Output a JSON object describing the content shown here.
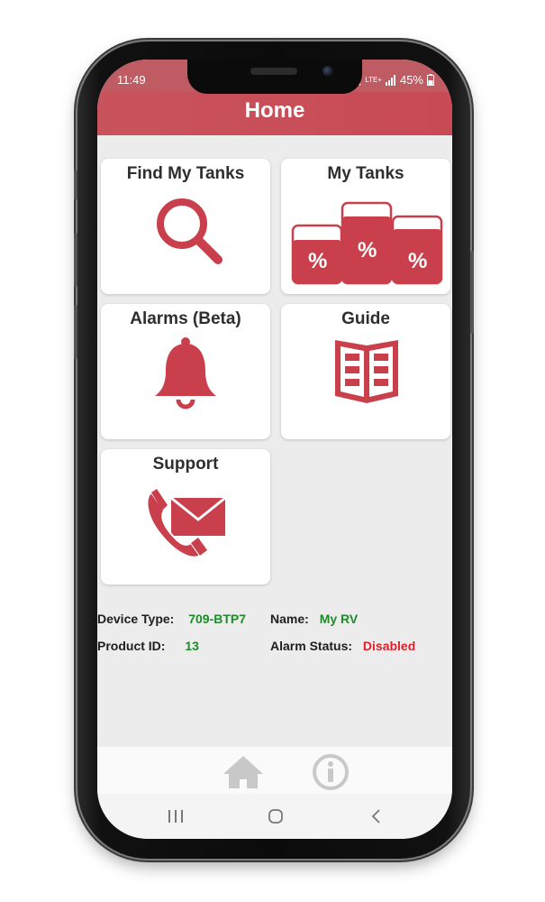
{
  "status_bar": {
    "time": "11:49",
    "network": "LTE+",
    "battery": "45%"
  },
  "app_bar": {
    "title": "Home"
  },
  "tiles": [
    {
      "label": "Find My Tanks",
      "icon": "search-icon"
    },
    {
      "label": "My Tanks",
      "icon": "tank-levels-icon",
      "badge": "%"
    },
    {
      "label": "Alarms (Beta)",
      "icon": "bell-icon"
    },
    {
      "label": "Guide",
      "icon": "book-icon"
    },
    {
      "label": "Support",
      "icon": "phone-mail-icon"
    }
  ],
  "device_info": {
    "device_type_label": "Device Type:",
    "device_type_value": "709-BTP7",
    "name_label": "Name:",
    "name_value": "My RV",
    "product_id_label": "Product ID:",
    "product_id_value": "13",
    "alarm_status_label": "Alarm Status:",
    "alarm_status_value": "Disabled"
  },
  "bottom_nav": [
    {
      "icon": "home-icon"
    },
    {
      "icon": "info-icon"
    }
  ],
  "system_nav": [
    {
      "icon": "recents-icon"
    },
    {
      "icon": "home-circle-icon"
    },
    {
      "icon": "back-icon"
    }
  ],
  "colors": {
    "accent": "#c84a54",
    "icon_red": "#c9404c",
    "value_green": "#1f8a2a",
    "value_red": "#e0202a",
    "nav_gray": "#c8c8c8"
  }
}
